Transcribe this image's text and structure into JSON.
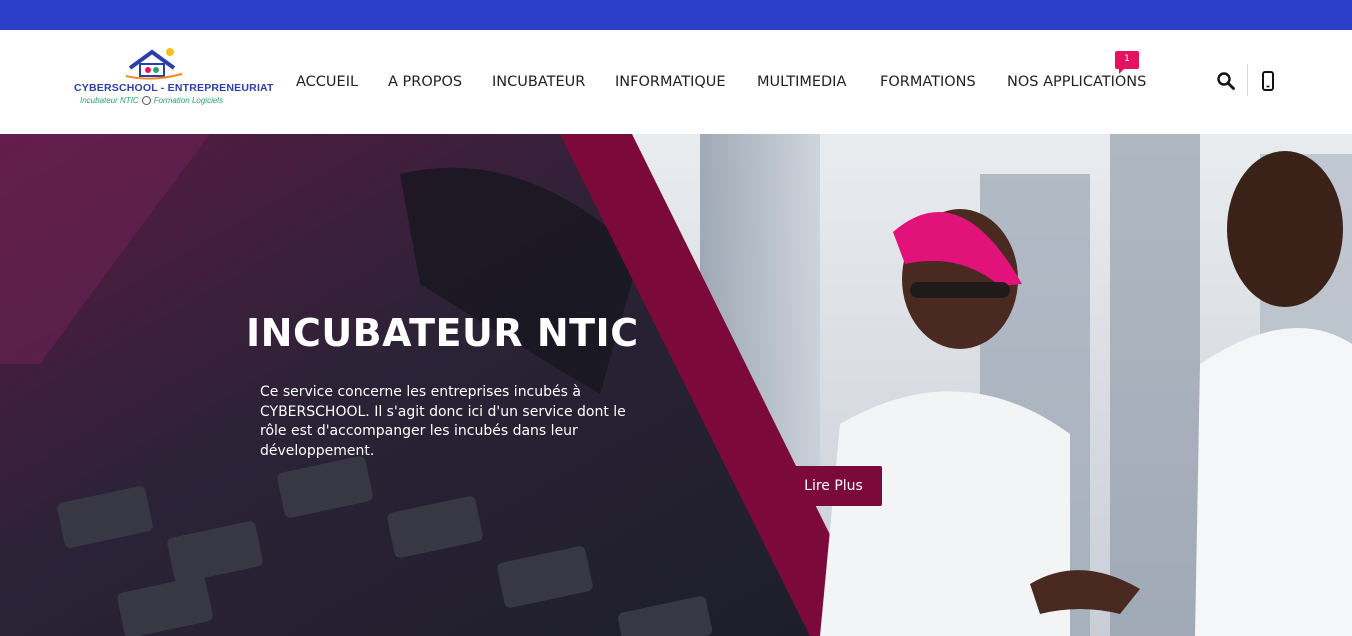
{
  "brand": {
    "name": "CYBERSCHOOL - ENTREPRENEURIAT",
    "tagline_left": "Incubateur NTIC",
    "tagline_right": "Formation Logiciels"
  },
  "nav": {
    "items": [
      {
        "label": "ACCUEIL"
      },
      {
        "label": "A PROPOS"
      },
      {
        "label": "INCUBATEUR"
      },
      {
        "label": "INFORMATIQUE"
      },
      {
        "label": "MULTIMEDIA"
      },
      {
        "label": "FORMATIONS"
      },
      {
        "label": "NOS APPLICATIONS",
        "badge": "1"
      }
    ]
  },
  "icons": {
    "search": "search-icon",
    "phone": "mobile-phone-icon"
  },
  "hero": {
    "title": "INCUBATEUR NTIC",
    "description": "Ce service concerne les entreprises incubés à CYBERSCHOOL. Il s'agit donc ici d'un service dont le rôle est d'accompanger les incubés dans leur développement.",
    "cta_label": "Lire Plus"
  },
  "colors": {
    "topbar": "#2c3fcb",
    "accent": "#7b0a3b",
    "badge": "#e3135f"
  }
}
